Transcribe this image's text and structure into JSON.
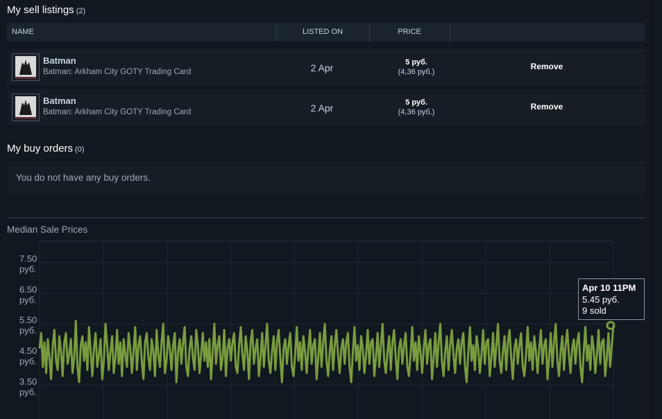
{
  "sell_listings": {
    "title": "My sell listings",
    "count": "(2)",
    "headers": {
      "name": "NAME",
      "listed_on": "LISTED ON",
      "price": "PRICE"
    },
    "rows": [
      {
        "item_name": "Batman",
        "game": "Batman: Arkham City GOTY Trading Card",
        "listed_on": "2 Apr",
        "price": "5 руб.",
        "price_sub": "(4,36 руб.)",
        "action": "Remove"
      },
      {
        "item_name": "Batman",
        "game": "Batman: Arkham City GOTY Trading Card",
        "listed_on": "2 Apr",
        "price": "5 руб.",
        "price_sub": "(4,36 руб.)",
        "action": "Remove"
      }
    ]
  },
  "buy_orders": {
    "title": "My buy orders",
    "count": "(0)",
    "empty_message": "You do not have any buy orders."
  },
  "chart_title": "Median Sale Prices",
  "tooltip": {
    "date": "Apr 10 11PM",
    "price": "5.45 руб.",
    "sold": "9 sold"
  },
  "colors": {
    "background": "#111820",
    "line": "#7a9b3e",
    "row_bg": "#161d25",
    "header_bg": "#1b232d"
  },
  "chart_data": {
    "type": "line",
    "title": "Median Sale Prices",
    "y_ticks": [
      {
        "value": 7.5,
        "label": "7.50",
        "unit": "руб."
      },
      {
        "value": 6.5,
        "label": "6.50",
        "unit": "руб."
      },
      {
        "value": 5.5,
        "label": "5.50",
        "unit": "руб."
      },
      {
        "value": 4.5,
        "label": "4.50",
        "unit": "руб."
      },
      {
        "value": 3.5,
        "label": "3.50",
        "unit": "руб."
      }
    ],
    "ylim": [
      2.4,
      8.2
    ],
    "grid": true,
    "series": [
      {
        "values": [
          4.7,
          5.2,
          4.1,
          4.9,
          3.9,
          5.0,
          4.4,
          3.7,
          4.8,
          5.3,
          4.3,
          4.0,
          5.1,
          4.6,
          3.8,
          4.9,
          5.2,
          4.2,
          4.5,
          5.0,
          3.9,
          4.4,
          5.6,
          4.1,
          3.6,
          4.8,
          5.1,
          4.3,
          4.9,
          4.0,
          5.4,
          4.6,
          3.8,
          4.7,
          5.2,
          4.1,
          4.5,
          5.0,
          3.7,
          4.3,
          5.5,
          4.8,
          4.0,
          4.6,
          5.1,
          3.9,
          4.4,
          5.3,
          4.2,
          4.9,
          3.8,
          5.0,
          4.5,
          4.1,
          5.2,
          4.7,
          3.9,
          4.6,
          5.4,
          4.0,
          4.8,
          5.1,
          4.3,
          3.7,
          4.9,
          5.2,
          4.4,
          4.0,
          5.0,
          4.6,
          3.8,
          5.3,
          4.5,
          4.1,
          4.9,
          5.5,
          3.9,
          4.3,
          5.1,
          4.7,
          4.0,
          4.8,
          5.2,
          3.6,
          4.6,
          5.0,
          4.2,
          4.9,
          5.4,
          4.1,
          3.8,
          4.7,
          5.1,
          4.4,
          4.0,
          5.3,
          4.8,
          3.9,
          4.5,
          5.2,
          4.3,
          4.9,
          4.1,
          5.0,
          3.7,
          4.6,
          5.5,
          4.2,
          4.8,
          5.1,
          4.0,
          4.4,
          5.3,
          3.8,
          4.7,
          5.0,
          4.3,
          4.9,
          5.2,
          4.1,
          3.9,
          4.8,
          5.4,
          4.5,
          4.0,
          5.1,
          4.6,
          3.7,
          4.9,
          5.3,
          4.2,
          4.7,
          5.0,
          3.8,
          4.4,
          5.2,
          4.1,
          4.8,
          5.5,
          4.3,
          3.9,
          4.6,
          5.1,
          4.0,
          4.9,
          5.3,
          4.4,
          3.6,
          4.7,
          5.0,
          4.2,
          4.8,
          5.2,
          4.1,
          3.8,
          4.5,
          5.4,
          4.3,
          4.9,
          4.0,
          5.1,
          4.6,
          3.9,
          4.7,
          5.3,
          4.2,
          4.8,
          5.0,
          3.7,
          4.4,
          5.2,
          4.1,
          4.9,
          5.5,
          4.3,
          3.8,
          4.6,
          5.1,
          4.0,
          4.8,
          5.3,
          4.5,
          3.9,
          4.7,
          5.0,
          4.2,
          4.9,
          5.2,
          4.1,
          3.6,
          4.6,
          5.4,
          4.3,
          4.8,
          4.0,
          5.1,
          4.7,
          3.9,
          4.5,
          5.3,
          4.2,
          4.9,
          5.0,
          3.8,
          4.4,
          5.2,
          4.1,
          4.8,
          5.5,
          4.3,
          3.9,
          4.6,
          5.1,
          4.0,
          4.9,
          5.3,
          4.4,
          3.7,
          4.7,
          5.0,
          4.2,
          4.8,
          5.2,
          4.1,
          3.8,
          4.5,
          5.4,
          4.3,
          4.9,
          4.0,
          5.1,
          4.6,
          3.9,
          4.7,
          5.3,
          4.2,
          4.8,
          5.0,
          3.7,
          4.4,
          5.2,
          4.1,
          4.9,
          5.5,
          4.3,
          3.8,
          4.6,
          5.1,
          4.0,
          4.8,
          5.3,
          4.5,
          3.9,
          4.7,
          5.0,
          4.2,
          4.9,
          5.2,
          4.1,
          3.6,
          4.6,
          5.4,
          4.3,
          4.8,
          4.0,
          5.1,
          4.7,
          3.9,
          4.5,
          5.3,
          4.2,
          4.9,
          5.0,
          3.8,
          4.4,
          5.2,
          4.1,
          4.8,
          5.5,
          4.3,
          3.9,
          4.6,
          5.1,
          4.0,
          4.9,
          5.3,
          4.4,
          3.7,
          4.7,
          5.0,
          4.2,
          4.8,
          5.2,
          4.1,
          3.8,
          4.5,
          5.4,
          4.3,
          4.9,
          4.0,
          5.1,
          4.6,
          3.9,
          4.7,
          5.3,
          4.2,
          4.8,
          5.0,
          3.7,
          4.4,
          5.2,
          4.1,
          4.9,
          5.5,
          4.3,
          3.8,
          4.6,
          5.1,
          4.0,
          4.8,
          5.3,
          4.5,
          3.9,
          4.7,
          5.0,
          4.2,
          4.9,
          5.2,
          4.1,
          3.6,
          4.6,
          5.4,
          4.3,
          4.8,
          4.0,
          5.1,
          4.7,
          3.9,
          4.5,
          5.3,
          4.2,
          4.9,
          5.0,
          3.8,
          4.4,
          5.2,
          4.1,
          4.8,
          5.45
        ]
      }
    ]
  }
}
